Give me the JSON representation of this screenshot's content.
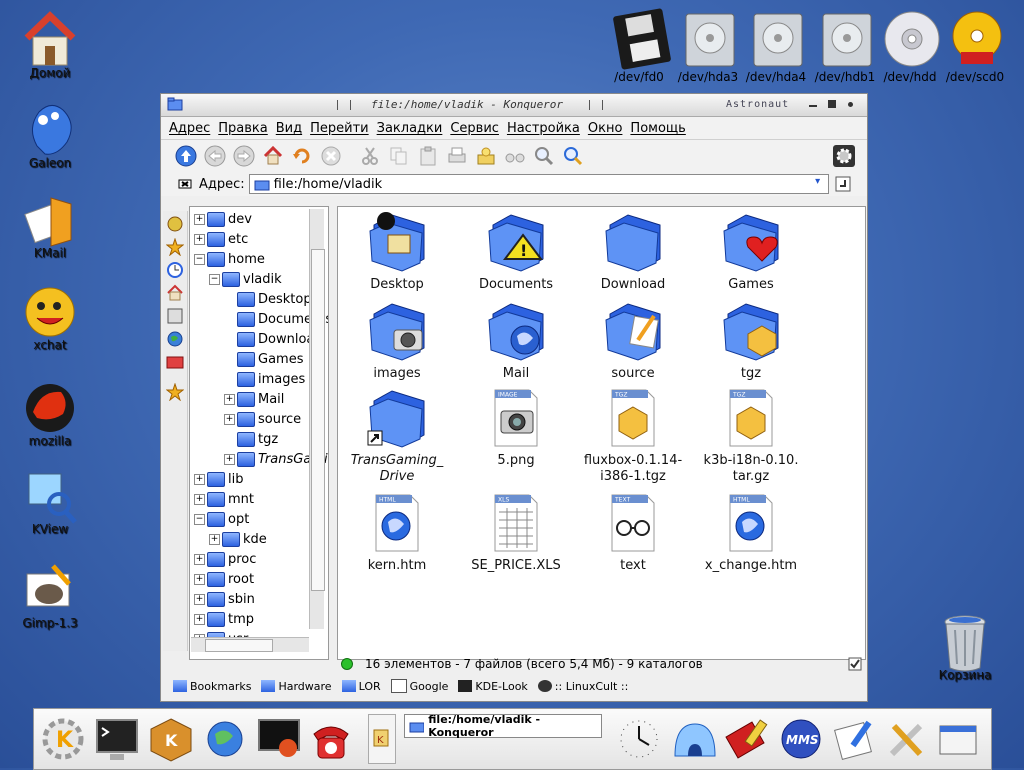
{
  "desktop_icons": [
    {
      "label": "Домой",
      "icon": "home-icon"
    },
    {
      "label": "Galeon",
      "icon": "galeon-icon"
    },
    {
      "label": "KMail",
      "icon": "kmail-icon"
    },
    {
      "label": "xchat",
      "icon": "xchat-icon"
    },
    {
      "label": "mozilla",
      "icon": "mozilla-icon"
    },
    {
      "label": "KView",
      "icon": "kview-icon"
    },
    {
      "label": "Gimp-1.3",
      "icon": "gimp-icon"
    }
  ],
  "drives": [
    {
      "label": "/dev/fd0",
      "icon": "floppy-icon"
    },
    {
      "label": "/dev/hda3",
      "icon": "harddisk-icon"
    },
    {
      "label": "/dev/hda4",
      "icon": "harddisk-icon"
    },
    {
      "label": "/dev/hdb1",
      "icon": "harddisk-icon"
    },
    {
      "label": "/dev/hdd",
      "icon": "cdrom-icon"
    },
    {
      "label": "/dev/scd0",
      "icon": "cdwriter-icon"
    }
  ],
  "trash": {
    "label": "Корзина"
  },
  "window": {
    "title": "file:/home/vladik - Konqueror",
    "brand": "Astronaut",
    "menu": [
      "Адрес",
      "Правка",
      "Вид",
      "Перейти",
      "Закладки",
      "Сервис",
      "Настройка",
      "Окно",
      "Помощь"
    ],
    "location_label": "Адрес:",
    "location_value": "file:/home/vladik",
    "status": "16 элементов - 7 файлов (всего 5,4 Мб) - 9 каталогов"
  },
  "tree": [
    {
      "label": "dev",
      "level": 0,
      "exp": "+"
    },
    {
      "label": "etc",
      "level": 0,
      "exp": "+"
    },
    {
      "label": "home",
      "level": 0,
      "exp": "-"
    },
    {
      "label": "vladik",
      "level": 1,
      "exp": "-"
    },
    {
      "label": "Desktop",
      "level": 2,
      "exp": ""
    },
    {
      "label": "Documents",
      "level": 2,
      "exp": ""
    },
    {
      "label": "Download",
      "level": 2,
      "exp": ""
    },
    {
      "label": "Games",
      "level": 2,
      "exp": ""
    },
    {
      "label": "images",
      "level": 2,
      "exp": ""
    },
    {
      "label": "Mail",
      "level": 2,
      "exp": "+"
    },
    {
      "label": "source",
      "level": 2,
      "exp": "+"
    },
    {
      "label": "tgz",
      "level": 2,
      "exp": ""
    },
    {
      "label": "TransGaming_Drive",
      "level": 2,
      "exp": "+"
    },
    {
      "label": "lib",
      "level": 0,
      "exp": "+"
    },
    {
      "label": "mnt",
      "level": 0,
      "exp": "+"
    },
    {
      "label": "opt",
      "level": 0,
      "exp": "-"
    },
    {
      "label": "kde",
      "level": 1,
      "exp": "+"
    },
    {
      "label": "proc",
      "level": 0,
      "exp": "+"
    },
    {
      "label": "root",
      "level": 0,
      "exp": "+"
    },
    {
      "label": "sbin",
      "level": 0,
      "exp": "+"
    },
    {
      "label": "tmp",
      "level": 0,
      "exp": "+"
    },
    {
      "label": "usr",
      "level": 0,
      "exp": "+"
    }
  ],
  "files": [
    {
      "name": "Desktop",
      "icon": "desktop-folder-icon"
    },
    {
      "name": "Documents",
      "icon": "documents-folder-icon"
    },
    {
      "name": "Download",
      "icon": "download-folder-icon"
    },
    {
      "name": "Games",
      "icon": "games-folder-icon"
    },
    {
      "name": "images",
      "icon": "images-folder-icon"
    },
    {
      "name": "Mail",
      "icon": "mail-folder-icon"
    },
    {
      "name": "source",
      "icon": "source-folder-icon"
    },
    {
      "name": "tgz",
      "icon": "tgz-folder-icon"
    },
    {
      "name": "TransGaming_ Drive",
      "icon": "link-folder-icon"
    },
    {
      "name": "5.png",
      "icon": "image-file-icon"
    },
    {
      "name": "fluxbox-0.1.14- i386-1.tgz",
      "icon": "archive-file-icon"
    },
    {
      "name": "k3b-i18n-0.10. tar.gz",
      "icon": "archive-file-icon"
    },
    {
      "name": "kern.htm",
      "icon": "html-file-icon"
    },
    {
      "name": "SE_PRICE.XLS",
      "icon": "spreadsheet-file-icon"
    },
    {
      "name": "text",
      "icon": "text-file-icon"
    },
    {
      "name": "x_change.htm",
      "icon": "html-file-icon"
    }
  ],
  "bookmarks": [
    "Bookmarks",
    "Hardware",
    "LOR",
    "Google",
    "KDE-Look",
    ":: LinuxCult ::"
  ],
  "taskbar": {
    "task_title": "file:/home/vladik - Konqueror"
  },
  "colors": {
    "accent": "#2d62e0",
    "desktop": "#3f69b4"
  }
}
